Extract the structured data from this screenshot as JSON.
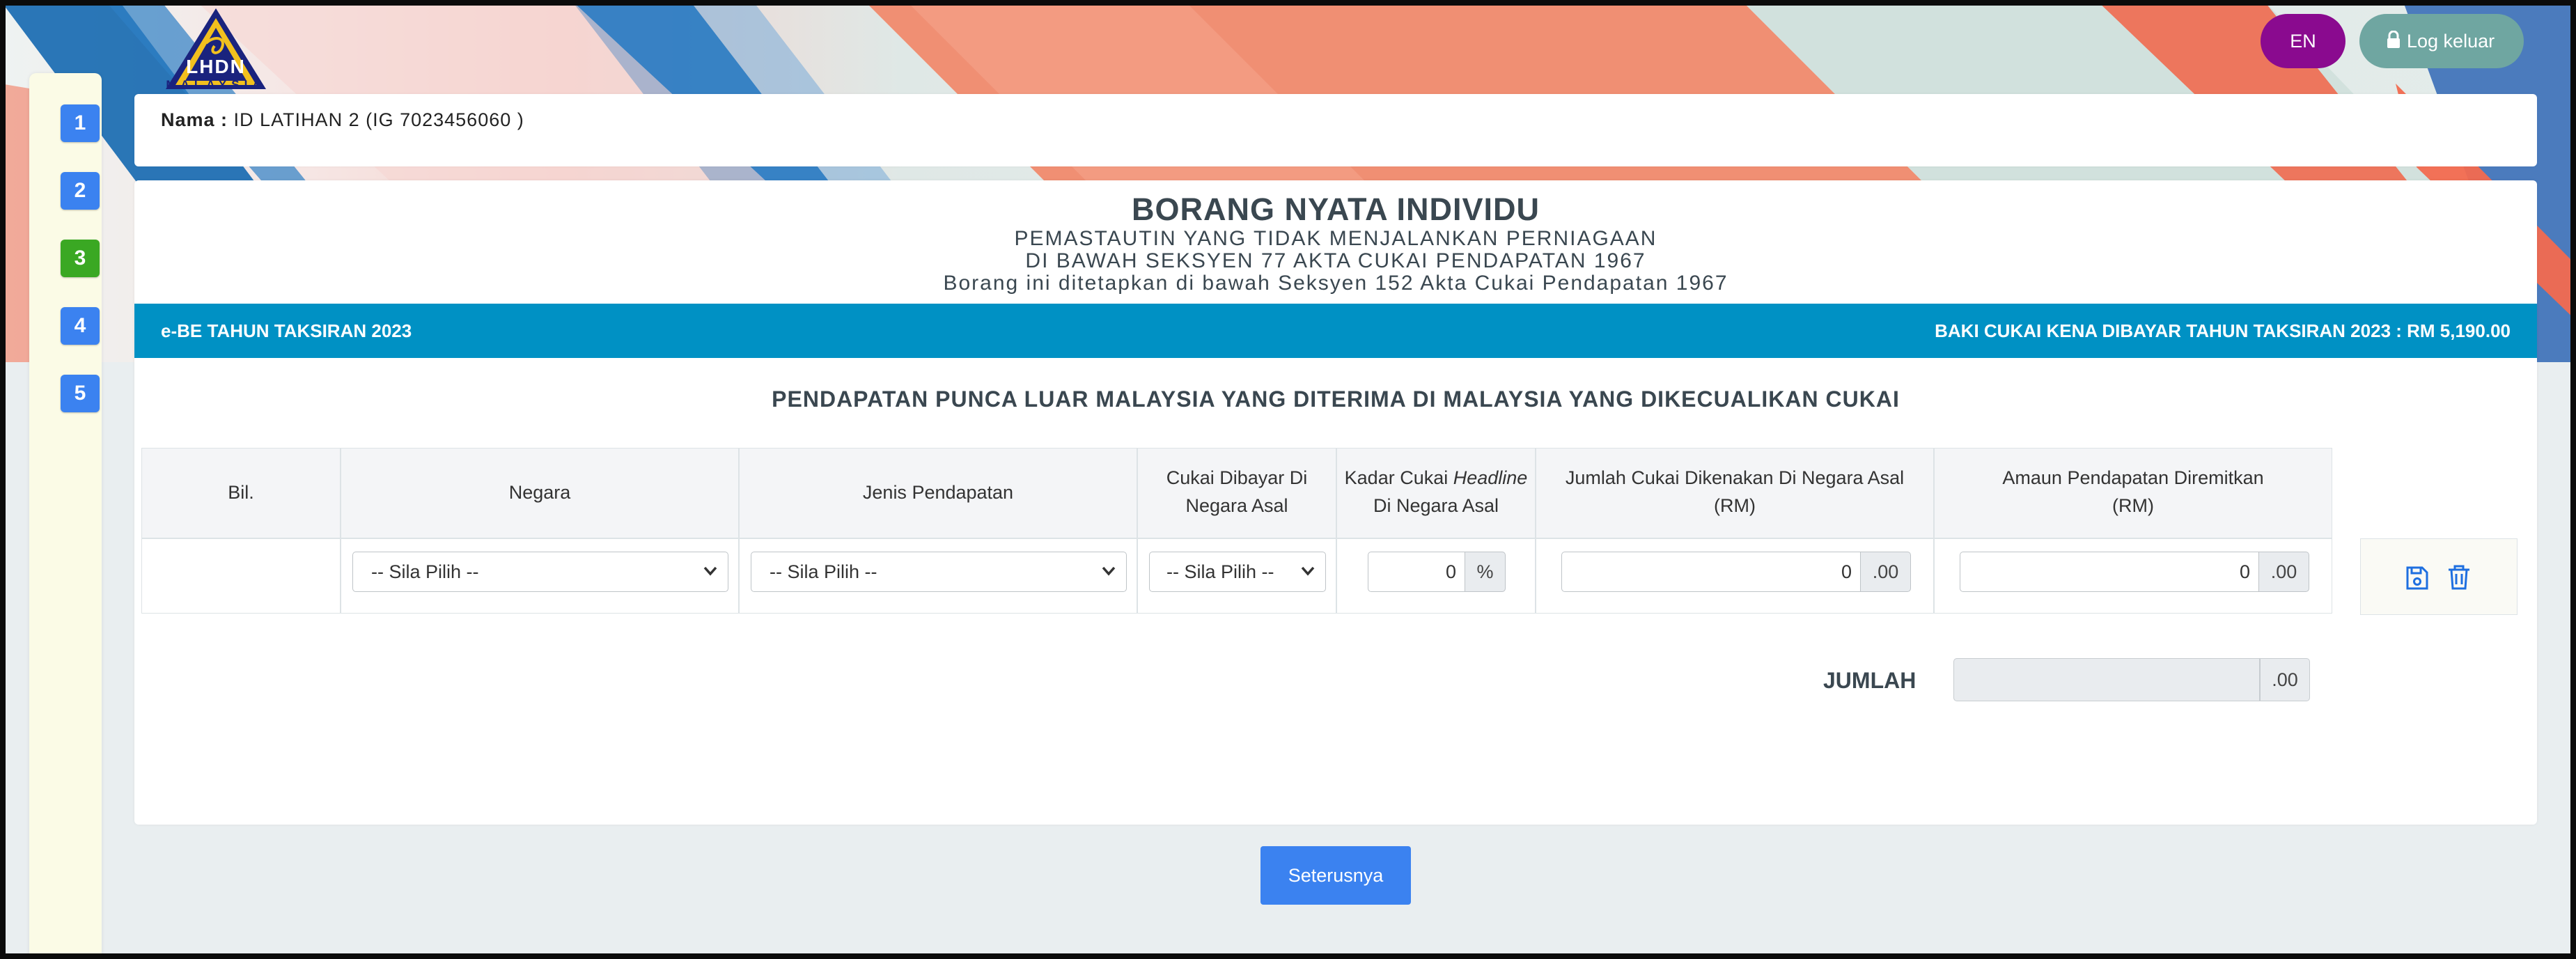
{
  "logo": {
    "text": "LHDN",
    "sub": "MALAYSIA"
  },
  "top_buttons": {
    "language": "EN",
    "logout": "Log keluar"
  },
  "steps": [
    "1",
    "2",
    "3",
    "4",
    "5"
  ],
  "active_step": "3",
  "user": {
    "label": "Nama :",
    "value": "ID LATIHAN 2 (IG 7023456060 )"
  },
  "form": {
    "title": "BORANG NYATA INDIVIDU",
    "subtitle_1": "PEMASTAUTIN YANG TIDAK MENJALANKAN PERNIAGAAN",
    "subtitle_2": "DI BAWAH SEKSYEN 77 AKTA CUKAI PENDAPATAN 1967",
    "subtitle_3": "Borang ini ditetapkan di bawah Seksyen 152 Akta Cukai Pendapatan 1967"
  },
  "info_bar": {
    "left": "e-BE TAHUN TAKSIRAN 2023",
    "right": "BAKI CUKAI KENA DIBAYAR TAHUN TAKSIRAN 2023 : RM 5,190.00"
  },
  "section_title": "PENDAPATAN PUNCA LUAR MALAYSIA YANG DITERIMA DI MALAYSIA YANG DIKECUALIKAN CUKAI",
  "table": {
    "headers": {
      "bil": "Bil.",
      "negara": "Negara",
      "jenis": "Jenis Pendapatan",
      "cukai_dibayar_1": "Cukai Dibayar Di",
      "cukai_dibayar_2": "Negara Asal",
      "kadar_1a": "Kadar Cukai ",
      "kadar_1b": "Headline",
      "kadar_2": "Di Negara Asal",
      "jumlah_1": "Jumlah Cukai Dikenakan Di Negara Asal",
      "jumlah_2": "(RM)",
      "amaun_1": "Amaun Pendapatan Diremitkan",
      "amaun_2": "(RM)"
    },
    "row": {
      "negara": "-- Sila Pilih --",
      "jenis": "-- Sila Pilih --",
      "cukai_dibayar": "-- Sila Pilih --",
      "kadar": "0",
      "kadar_suffix": "%",
      "jumlah": "0",
      "jumlah_suffix": ".00",
      "amaun": "0",
      "amaun_suffix": ".00"
    }
  },
  "total": {
    "label": "JUMLAH",
    "value": "",
    "suffix": ".00"
  },
  "next_button": "Seterusnya",
  "colors": {
    "step_blue": "#3b82f0",
    "step_active": "#3aa823",
    "info_bar": "#0091c4",
    "en_button": "#8a0a8f",
    "logout_button": "#6fa6a1"
  }
}
